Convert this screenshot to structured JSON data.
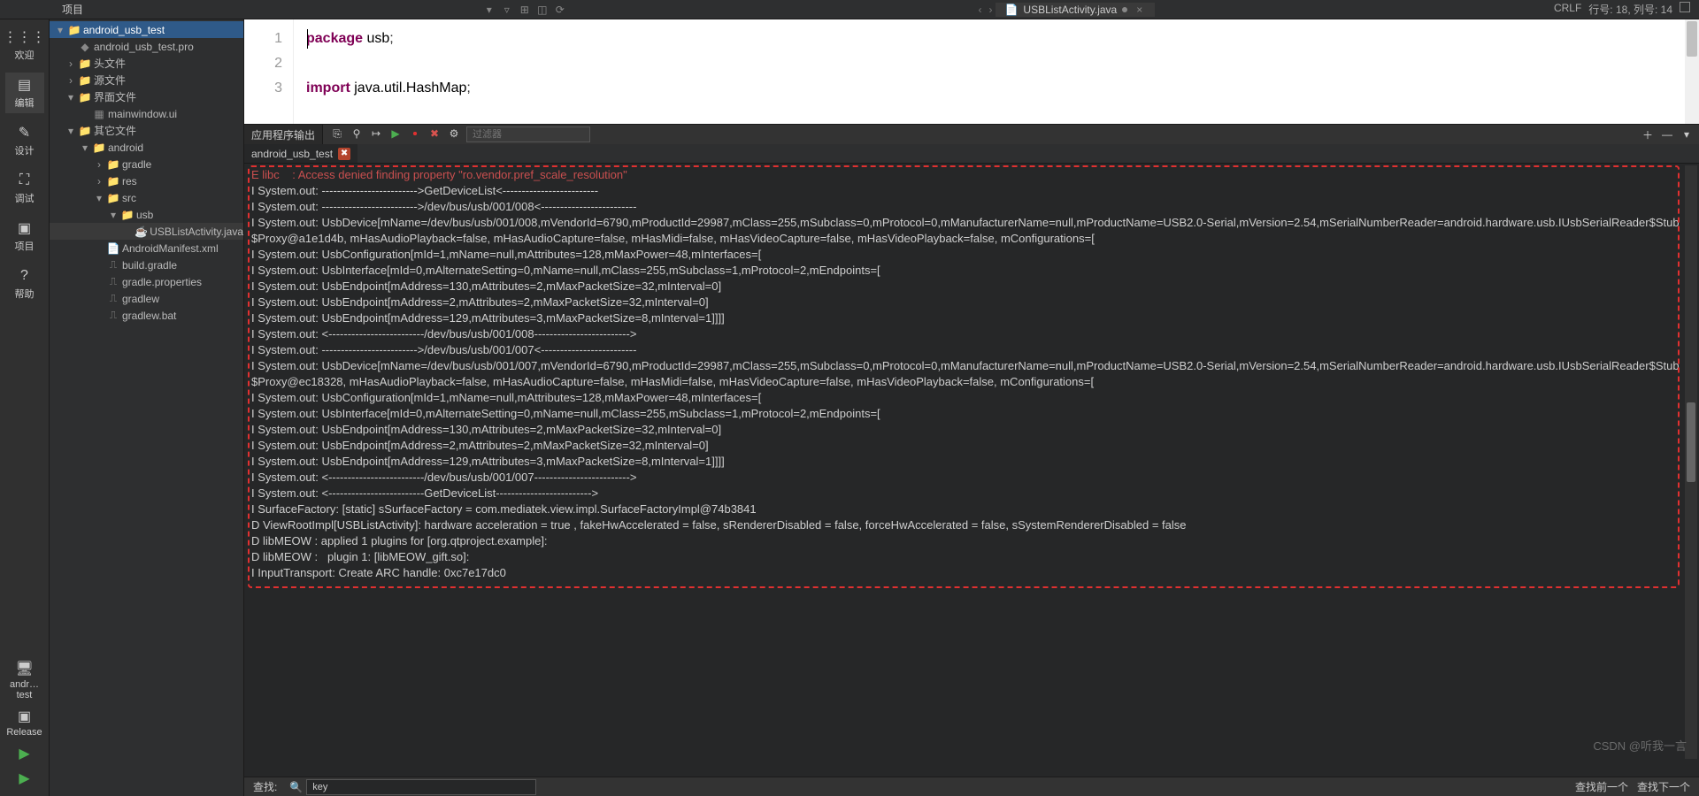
{
  "topbar": {
    "project_label": "项目",
    "editor_tab": "USBListActivity.java",
    "status_line": "行号: 18, 列号: 14",
    "status_crlf": "CRLF"
  },
  "leftbar": {
    "items": [
      {
        "icon": "⋮⋮⋮",
        "label": "欢迎"
      },
      {
        "icon": "▤",
        "label": "编辑"
      },
      {
        "icon": "✎",
        "label": "设计"
      },
      {
        "icon": "⛶",
        "label": "调试"
      },
      {
        "icon": "▣",
        "label": "项目"
      },
      {
        "icon": "?",
        "label": "帮助"
      }
    ],
    "bottom_project": "andr…test",
    "bottom_release": "Release"
  },
  "tree": {
    "nodes": [
      {
        "d": 0,
        "tw": "▾",
        "type": "folder",
        "label": "android_usb_test",
        "sel": true
      },
      {
        "d": 1,
        "tw": "",
        "type": "profile",
        "label": "android_usb_test.pro"
      },
      {
        "d": 1,
        "tw": "›",
        "type": "folder-h",
        "label": "头文件"
      },
      {
        "d": 1,
        "tw": "›",
        "type": "folder-h",
        "label": "源文件"
      },
      {
        "d": 1,
        "tw": "▾",
        "type": "folder-h",
        "label": "界面文件"
      },
      {
        "d": 2,
        "tw": "",
        "type": "ui",
        "label": "mainwindow.ui"
      },
      {
        "d": 1,
        "tw": "▾",
        "type": "folder-h",
        "label": "其它文件"
      },
      {
        "d": 2,
        "tw": "▾",
        "type": "folder",
        "label": "android"
      },
      {
        "d": 3,
        "tw": "›",
        "type": "folder",
        "label": "gradle"
      },
      {
        "d": 3,
        "tw": "›",
        "type": "folder",
        "label": "res"
      },
      {
        "d": 3,
        "tw": "▾",
        "type": "folder",
        "label": "src"
      },
      {
        "d": 4,
        "tw": "▾",
        "type": "folder",
        "label": "usb"
      },
      {
        "d": 5,
        "tw": "",
        "type": "java",
        "label": "USBListActivity.java",
        "cur": true
      },
      {
        "d": 3,
        "tw": "",
        "type": "xml",
        "label": "AndroidManifest.xml"
      },
      {
        "d": 3,
        "tw": "",
        "type": "gradle",
        "label": "build.gradle"
      },
      {
        "d": 3,
        "tw": "",
        "type": "gradle",
        "label": "gradle.properties"
      },
      {
        "d": 3,
        "tw": "",
        "type": "gradle",
        "label": "gradlew"
      },
      {
        "d": 3,
        "tw": "",
        "type": "gradle",
        "label": "gradlew.bat"
      }
    ]
  },
  "code": {
    "lines": [
      {
        "n": "1",
        "html": "<span class='kw'>package</span> <span class='pkg'>usb</span>;"
      },
      {
        "n": "2",
        "html": ""
      },
      {
        "n": "3",
        "html": "<span class='kw'>import</span> <span class='pkg'>java.util.HashMap</span>;"
      }
    ]
  },
  "panel": {
    "title": "应用程序输出",
    "filter_placeholder": "过滤器",
    "tab": "android_usb_test",
    "search_label": "查找:",
    "search_value": "key",
    "search_prev": "查找前一个",
    "search_next": "查找下一个"
  },
  "output_lines": [
    {
      "cls": "err",
      "t": "E libc    : Access denied finding property \"ro.vendor.pref_scale_resolution\""
    },
    {
      "t": "I System.out: ------------------------->GetDeviceList<-------------------------"
    },
    {
      "t": "I System.out: ------------------------->/dev/bus/usb/001/008<-------------------------"
    },
    {
      "t": "I System.out: UsbDevice[mName=/dev/bus/usb/001/008,mVendorId=6790,mProductId=29987,mClass=255,mSubclass=0,mProtocol=0,mManufacturerName=null,mProductName=USB2.0-Serial,mVersion=2.54,mSerialNumberReader=android.hardware.usb.IUsbSerialReader$Stub$Proxy@a1e1d4b, mHasAudioPlayback=false, mHasAudioCapture=false, mHasMidi=false, mHasVideoCapture=false, mHasVideoPlayback=false, mConfigurations=["
    },
    {
      "t": "I System.out: UsbConfiguration[mId=1,mName=null,mAttributes=128,mMaxPower=48,mInterfaces=["
    },
    {
      "t": "I System.out: UsbInterface[mId=0,mAlternateSetting=0,mName=null,mClass=255,mSubclass=1,mProtocol=2,mEndpoints=["
    },
    {
      "t": "I System.out: UsbEndpoint[mAddress=130,mAttributes=2,mMaxPacketSize=32,mInterval=0]"
    },
    {
      "t": "I System.out: UsbEndpoint[mAddress=2,mAttributes=2,mMaxPacketSize=32,mInterval=0]"
    },
    {
      "t": "I System.out: UsbEndpoint[mAddress=129,mAttributes=3,mMaxPacketSize=8,mInterval=1]]]]"
    },
    {
      "t": "I System.out: <-------------------------/dev/bus/usb/001/008------------------------->"
    },
    {
      "t": "I System.out: ------------------------->/dev/bus/usb/001/007<-------------------------"
    },
    {
      "t": "I System.out: UsbDevice[mName=/dev/bus/usb/001/007,mVendorId=6790,mProductId=29987,mClass=255,mSubclass=0,mProtocol=0,mManufacturerName=null,mProductName=USB2.0-Serial,mVersion=2.54,mSerialNumberReader=android.hardware.usb.IUsbSerialReader$Stub$Proxy@ec18328, mHasAudioPlayback=false, mHasAudioCapture=false, mHasMidi=false, mHasVideoCapture=false, mHasVideoPlayback=false, mConfigurations=["
    },
    {
      "t": "I System.out: UsbConfiguration[mId=1,mName=null,mAttributes=128,mMaxPower=48,mInterfaces=["
    },
    {
      "t": "I System.out: UsbInterface[mId=0,mAlternateSetting=0,mName=null,mClass=255,mSubclass=1,mProtocol=2,mEndpoints=["
    },
    {
      "t": "I System.out: UsbEndpoint[mAddress=130,mAttributes=2,mMaxPacketSize=32,mInterval=0]"
    },
    {
      "t": "I System.out: UsbEndpoint[mAddress=2,mAttributes=2,mMaxPacketSize=32,mInterval=0]"
    },
    {
      "t": "I System.out: UsbEndpoint[mAddress=129,mAttributes=3,mMaxPacketSize=8,mInterval=1]]]]"
    },
    {
      "t": "I System.out: <-------------------------/dev/bus/usb/001/007------------------------->"
    },
    {
      "t": "I System.out: <-------------------------GetDeviceList------------------------->"
    },
    {
      "t": "I SurfaceFactory: [static] sSurfaceFactory = com.mediatek.view.impl.SurfaceFactoryImpl@74b3841"
    },
    {
      "t": "D ViewRootImpl[USBListActivity]: hardware acceleration = true , fakeHwAccelerated = false, sRendererDisabled = false, forceHwAccelerated = false, sSystemRendererDisabled = false"
    },
    {
      "t": "D libMEOW : applied 1 plugins for [org.qtproject.example]:"
    },
    {
      "t": "D libMEOW :   plugin 1: [libMEOW_gift.so]:"
    },
    {
      "t": "I InputTransport: Create ARC handle: 0xc7e17dc0"
    }
  ],
  "watermark": "CSDN @听我一言"
}
